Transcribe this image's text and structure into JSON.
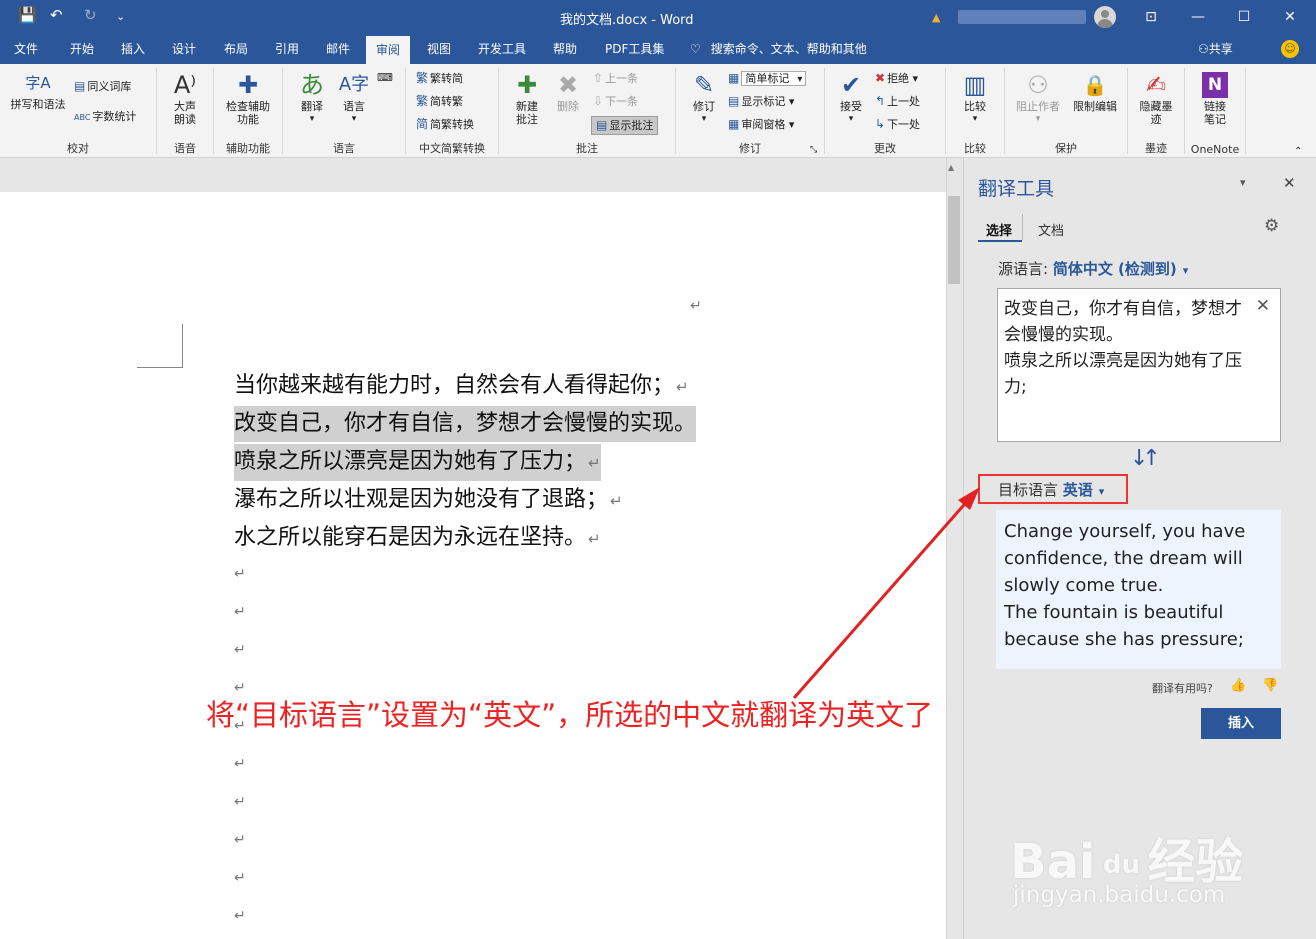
{
  "titlebar": {
    "document_title": "我的文档.docx  -  Word",
    "save_icon": "💾",
    "undo_icon": "↶",
    "redo_icon": "↻",
    "customize_icon": "⌄",
    "warn_icon": "▲",
    "ribbon_options_icon": "⊡",
    "minimize_icon": "—",
    "maximize_icon": "☐",
    "close_icon": "✕"
  },
  "tabs": [
    {
      "label": "文件"
    },
    {
      "label": "开始"
    },
    {
      "label": "插入"
    },
    {
      "label": "设计"
    },
    {
      "label": "布局"
    },
    {
      "label": "引用"
    },
    {
      "label": "邮件"
    },
    {
      "label": "审阅"
    },
    {
      "label": "视图"
    },
    {
      "label": "开发工具"
    },
    {
      "label": "帮助"
    },
    {
      "label": "PDF工具集"
    }
  ],
  "search": {
    "icon": "♡",
    "text": "搜索命令、文本、帮助和其他"
  },
  "share": {
    "label": "共享",
    "icon": "⚇"
  },
  "smiley": "☺",
  "ribbon": {
    "proofing": {
      "label": "校对",
      "spelling": "拼写和语法",
      "spelling_icon": "字A",
      "thesaurus": "同义词库",
      "thesaurus_icon": "▤",
      "word_count": "字数统计",
      "word_count_icon": "ABC"
    },
    "speech": {
      "label": "语音",
      "read_aloud": "大声朗读",
      "icon": "A⁾"
    },
    "accessibility": {
      "label": "辅助功能",
      "check": "检查辅助功能",
      "icon": "✚"
    },
    "language": {
      "label": "语言",
      "translate": "翻译",
      "translate_icon": "あ",
      "language": "语言",
      "language_icon": "A字",
      "small_icon": "⌨"
    },
    "chinese": {
      "label": "中文简繁转换",
      "to_simplified": "繁转简",
      "to_traditional": "简转繁",
      "convert": "简繁转换",
      "icon1": "繁",
      "icon2": "繁",
      "icon3": "简"
    },
    "comments": {
      "label": "批注",
      "new_comment": "新建批注",
      "delete": "删除",
      "previous": "上一条",
      "next": "下一条",
      "show_comments": "显示批注",
      "new_icon": "✚",
      "delete_icon": "✖",
      "prev_icon": "⇧",
      "next_icon": "⇩",
      "show_icon": "▤"
    },
    "tracking": {
      "label": "修订",
      "track": "修订",
      "markup": "简单标记",
      "show_markup": "显示标记",
      "reviewing_pane": "审阅窗格",
      "track_icon": "✎",
      "show_icon": "▤",
      "pane_icon": "▦",
      "launcher_icon": "⤡"
    },
    "changes": {
      "label": "更改",
      "accept": "接受",
      "reject": "拒绝",
      "previous": "上一处",
      "next": "下一处",
      "accept_icon": "✔",
      "reject_icon": "✖",
      "prev_icon": "↰",
      "next_icon": "↳"
    },
    "compare": {
      "label": "比较",
      "compare": "比较",
      "icon": "▥"
    },
    "protect": {
      "label": "保护",
      "block_authors": "阻止作者",
      "restrict_editing": "限制编辑",
      "block_icon": "⚇",
      "restrict_icon": "🔒"
    },
    "ink": {
      "label": "墨迹",
      "hide_ink": "隐藏墨迹",
      "icon": "✍"
    },
    "onenote": {
      "label": "OneNote",
      "linked_notes": "链接笔记",
      "icon": "N"
    }
  },
  "document": {
    "pilcrow": "↵",
    "lines": [
      "当你越来越有能力时，自然会有人看得起你；",
      "改变自己，你才有自信，梦想才会慢慢的实现。",
      "喷泉之所以漂亮是因为她有了压力；",
      "瀑布之所以壮观是因为她没有了退路；",
      "水之所以能穿石是因为永远在坚持。"
    ]
  },
  "pane": {
    "title": "翻译工具",
    "dropdown_icon": "▾",
    "close_icon": "✕",
    "tab_selection": "选择",
    "tab_document": "文档",
    "gear_icon": "⚙",
    "source_label": "源语言: ",
    "source_value": "简体中文 (检测到)",
    "source_arrow": "▾",
    "source_text": "改变自己，你才有自信，梦想才会慢慢的实现。\n喷泉之所以漂亮是因为她有了压力;",
    "clear_icon": "✕",
    "swap_icon": "↓↑",
    "target_label": "目标语言  ",
    "target_value": "英语",
    "target_arrow": "▾",
    "target_text": "Change yourself, you have confidence, the dream will slowly come true.\nThe fountain is beautiful because she has pressure;",
    "useful_prompt": "翻译有用吗?",
    "thumb_up": "👍",
    "thumb_down": "👎",
    "insert_button": "插入"
  },
  "annotation": {
    "text": "将“目标语言”设置为“英文”，所选的中文就翻译为英文了",
    "color": "#e22222"
  },
  "watermark": {
    "brand": "Bai",
    "brand2": "经验",
    "paw": "du",
    "url": "jingyan.baidu.com"
  },
  "colors": {
    "accent": "#2b579a",
    "highlight": "#d0d0d0",
    "annotation": "#e22222"
  }
}
